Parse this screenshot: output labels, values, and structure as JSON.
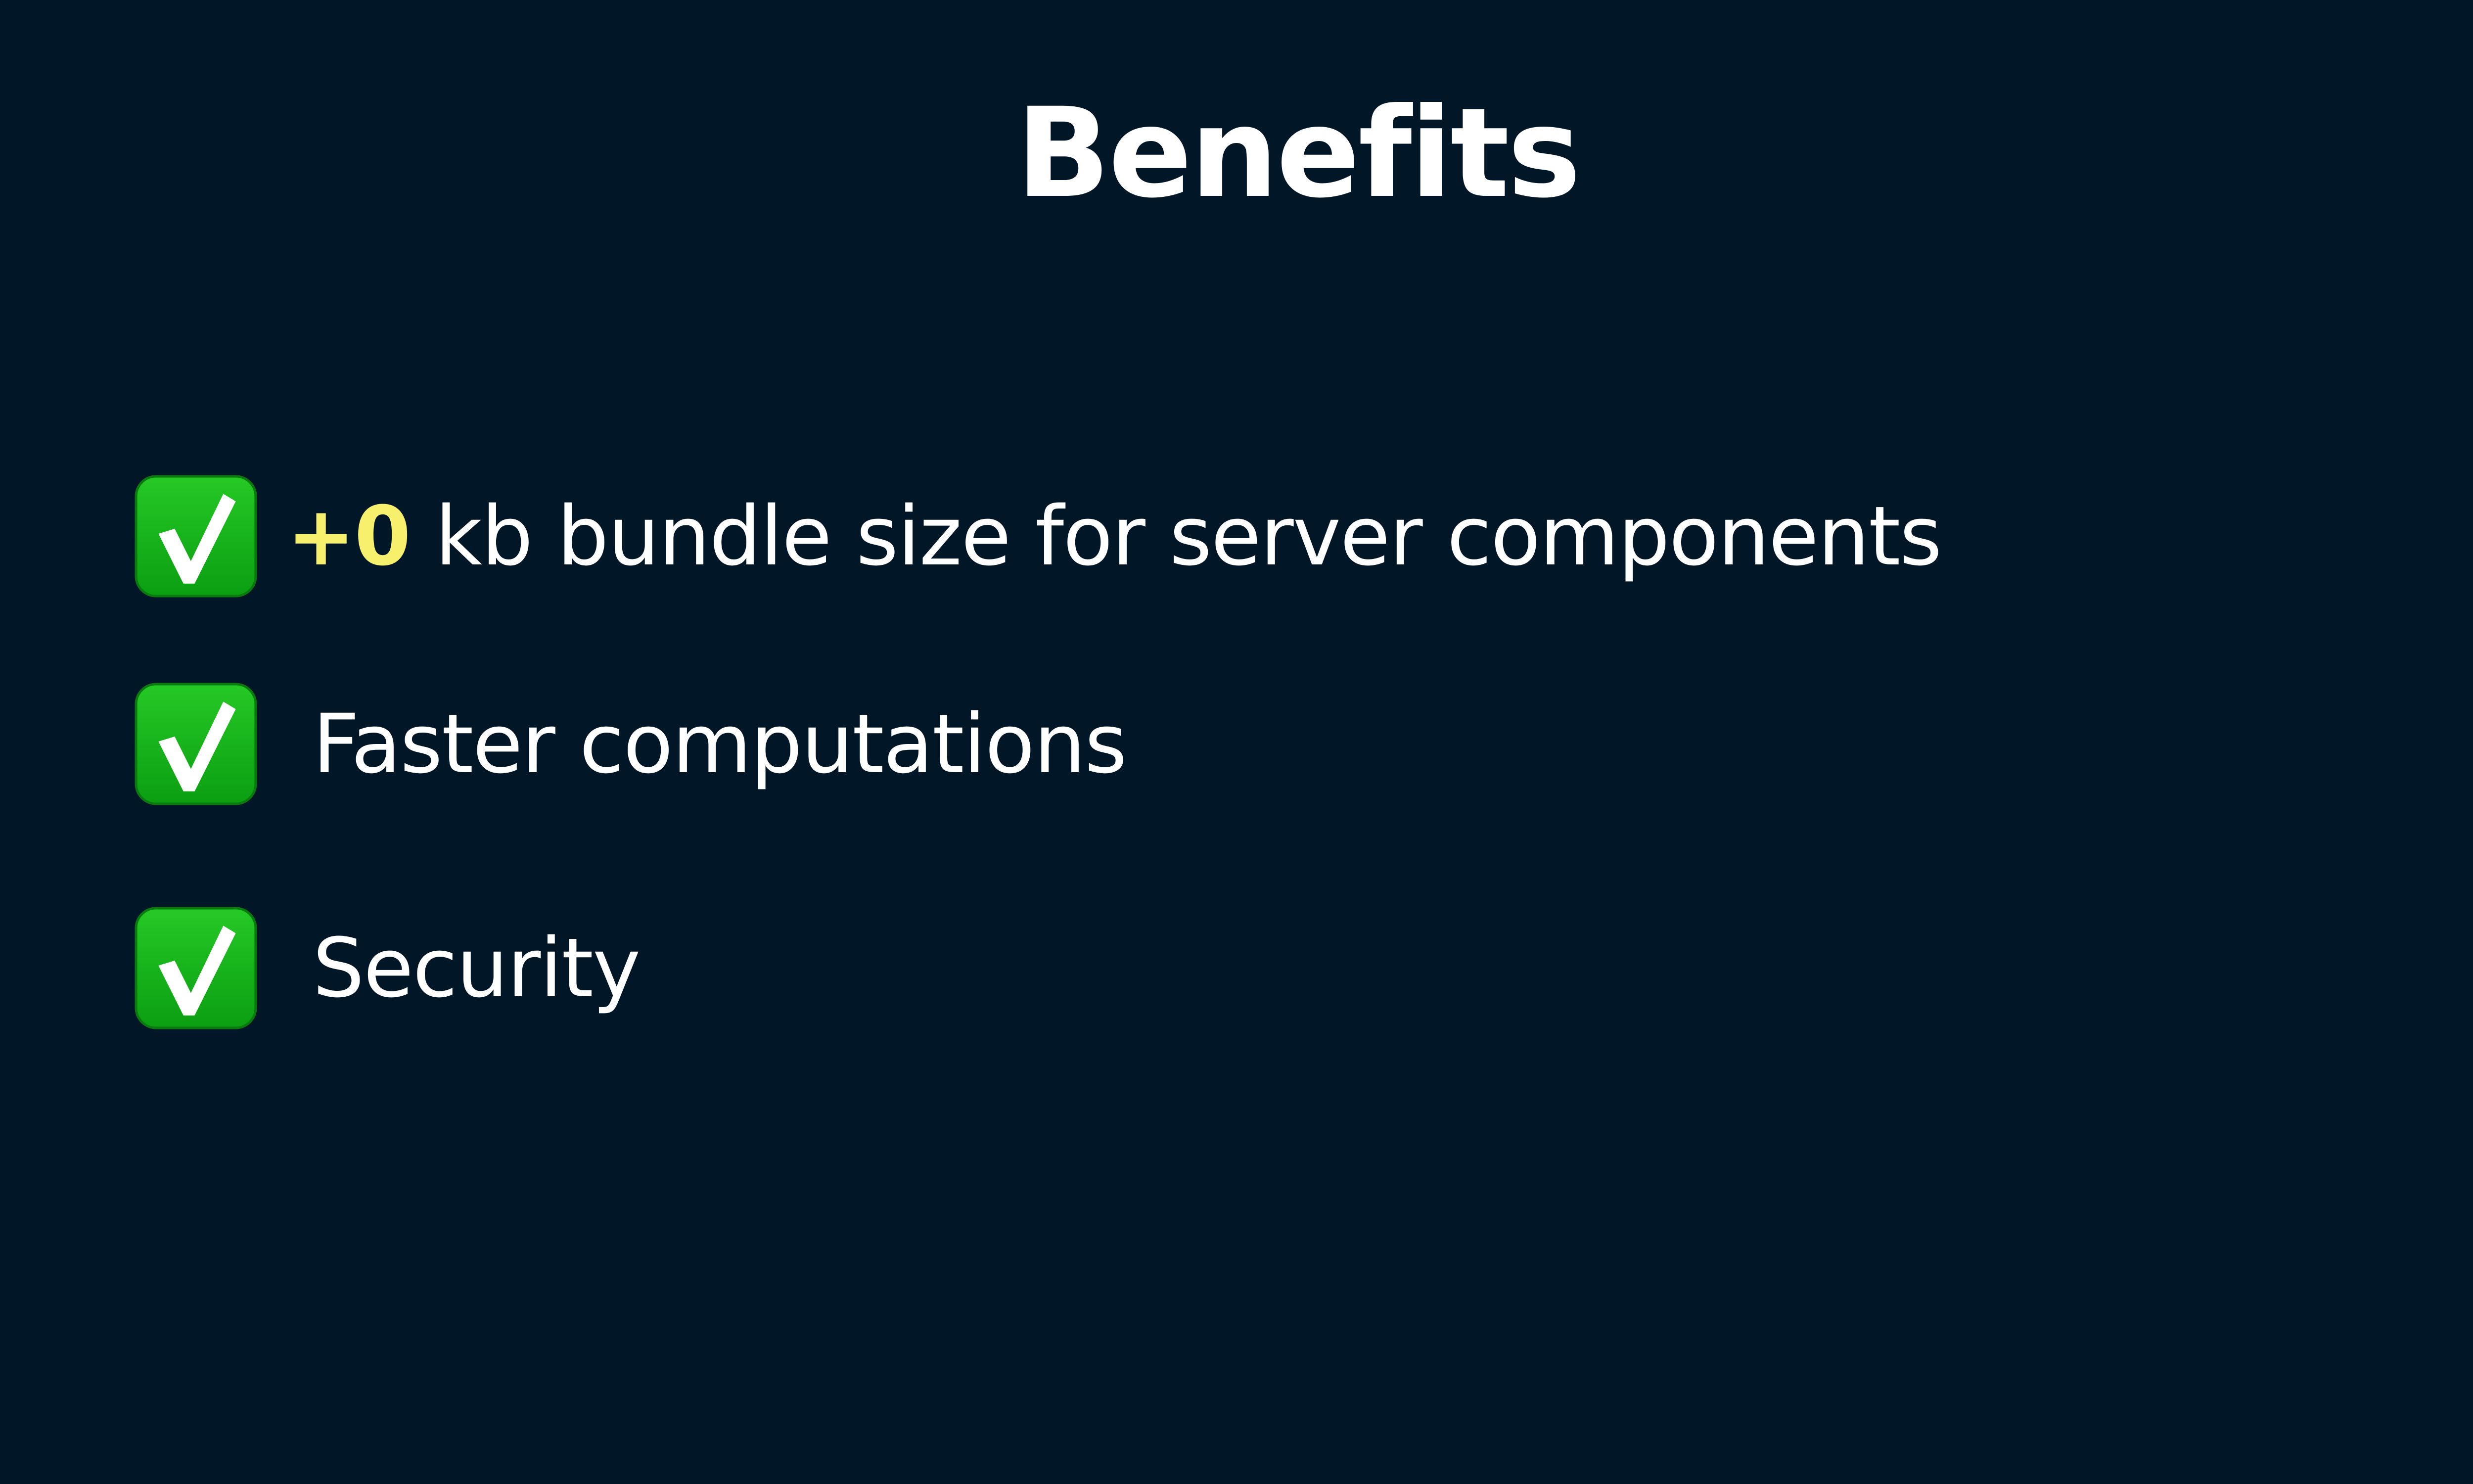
{
  "slide": {
    "title": "Benefits",
    "background_color": "#011627",
    "highlight_color": "#F7F06D",
    "items": [
      {
        "icon": "check-mark-button-icon",
        "highlight": "+0",
        "label": " kb bundle size for server components"
      },
      {
        "icon": "check-mark-button-icon",
        "label": "Faster computations"
      },
      {
        "icon": "check-mark-button-icon",
        "label": "Security"
      }
    ]
  }
}
